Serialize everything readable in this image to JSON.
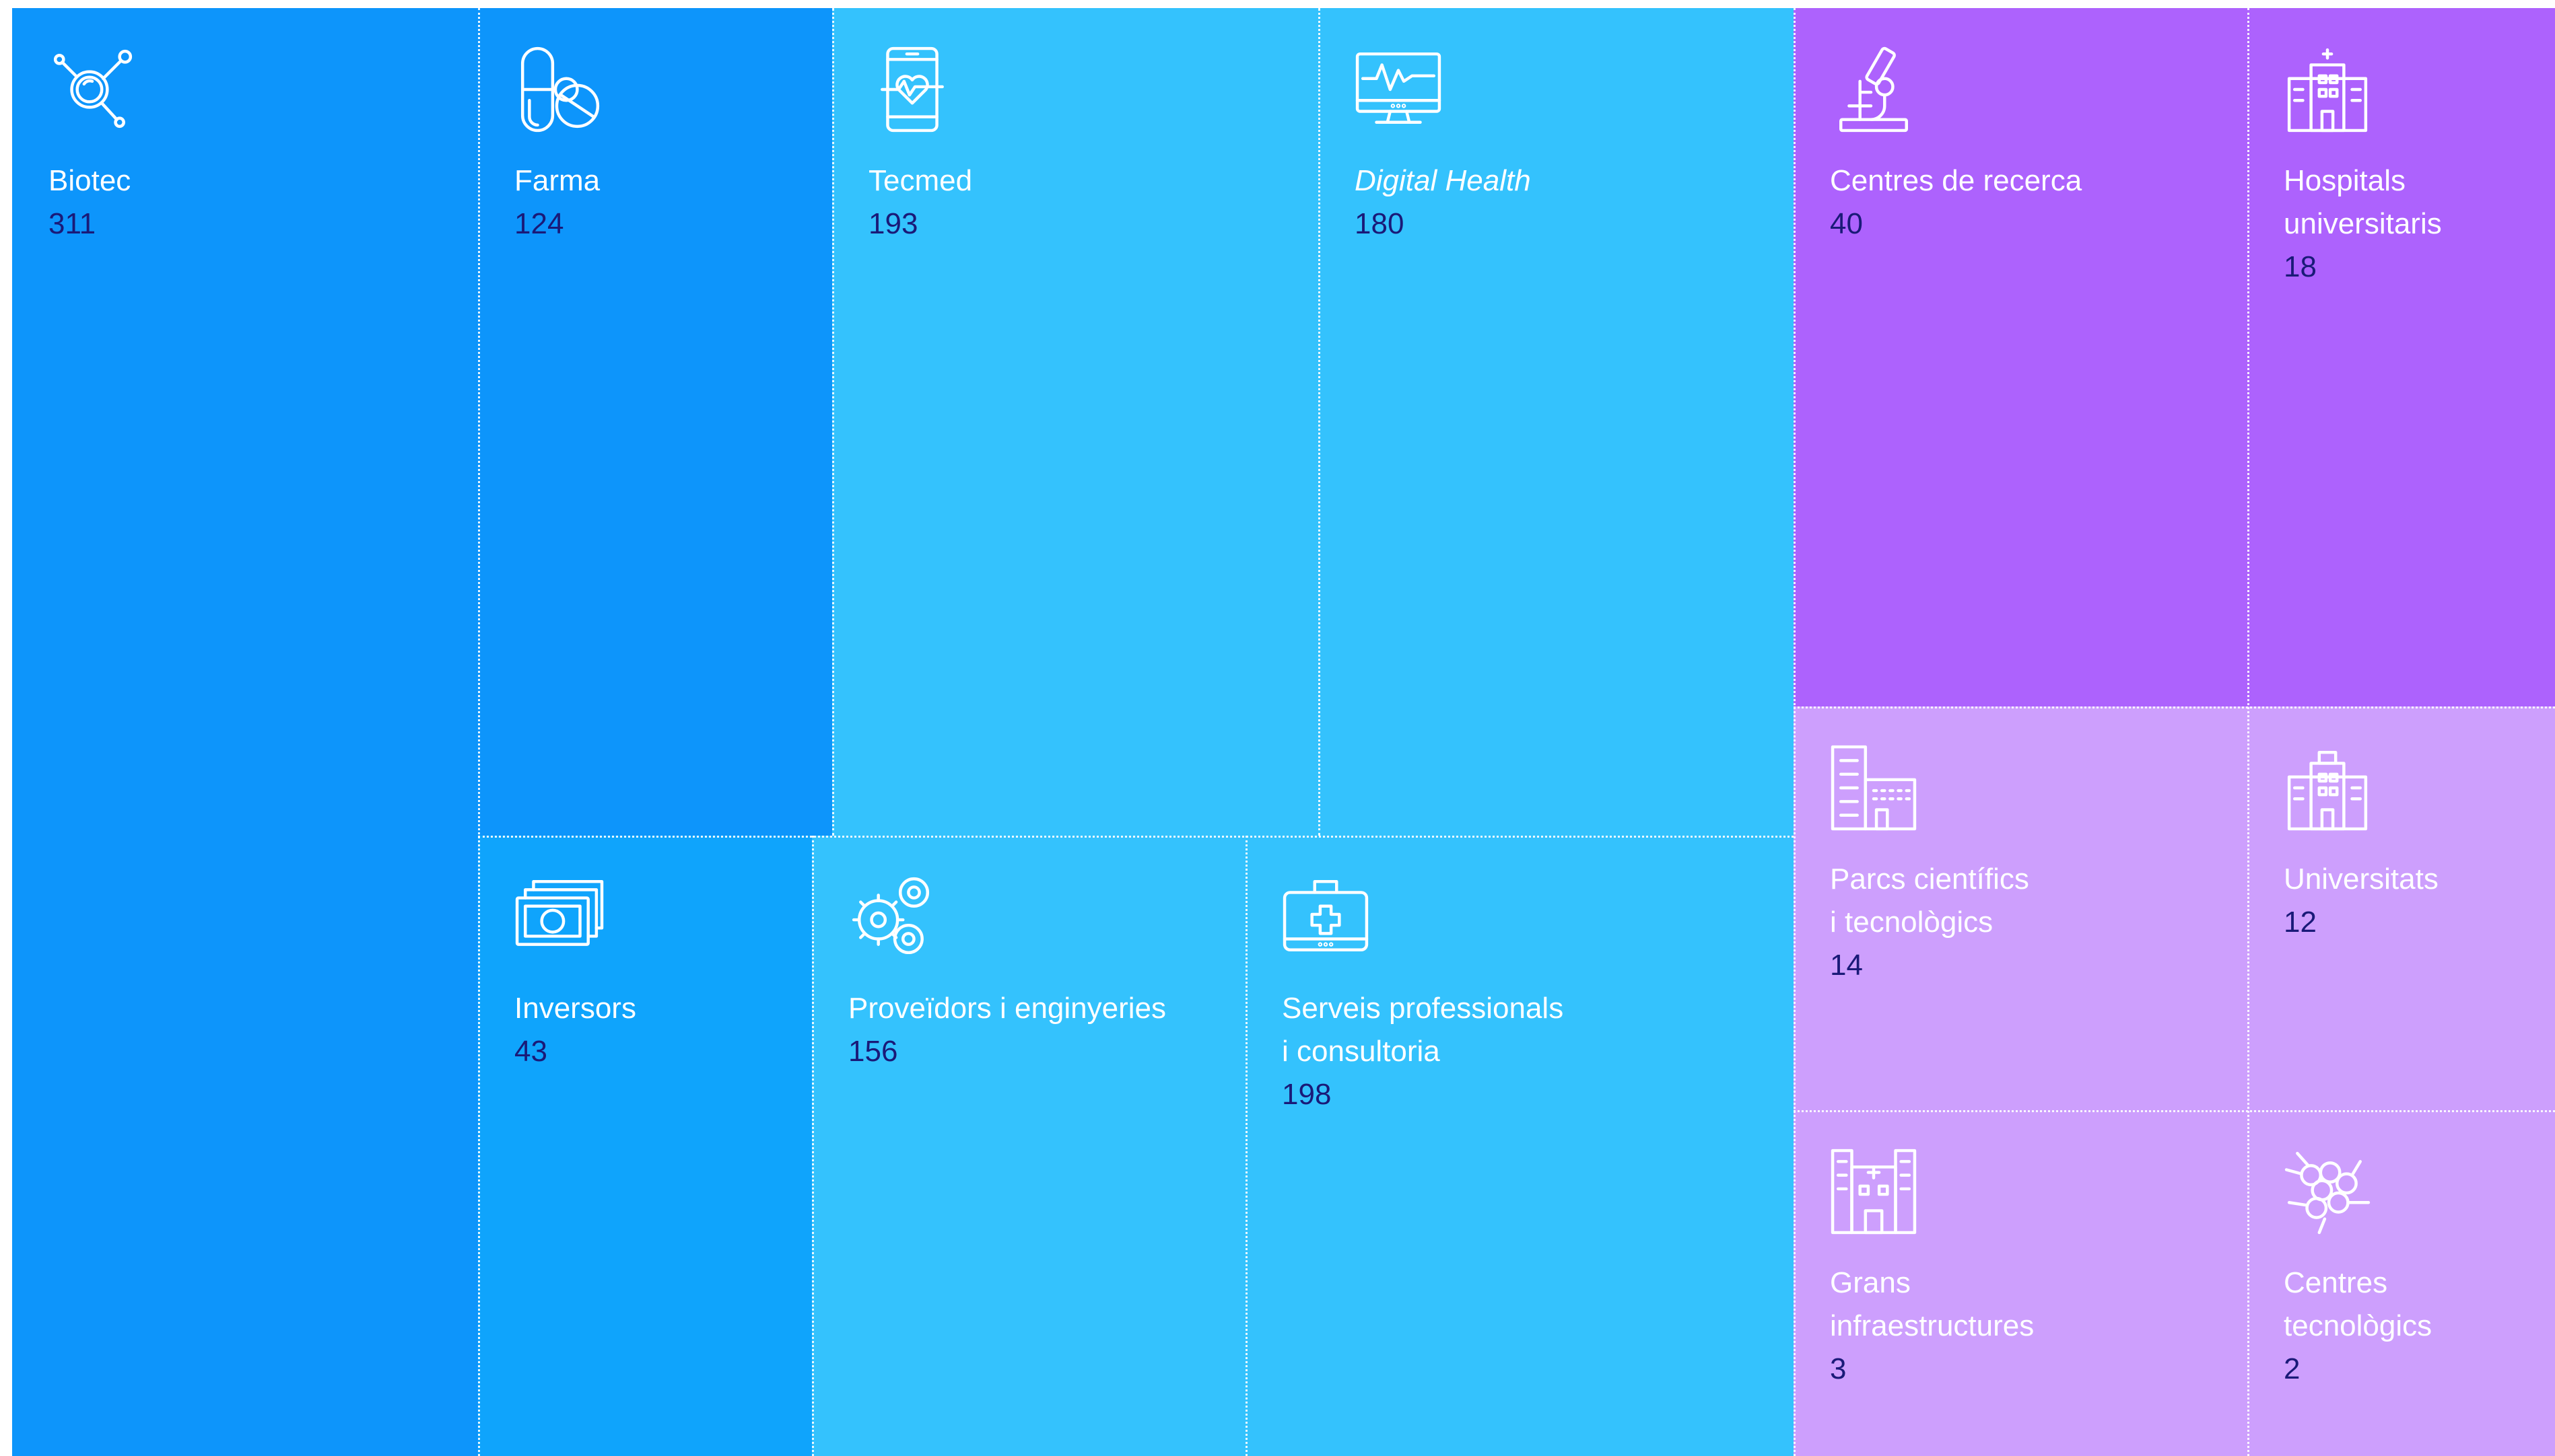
{
  "chart_data": {
    "type": "treemap",
    "title": "",
    "value_color": "#1a1a78",
    "groups": [
      {
        "color": "#0f9bff",
        "items": [
          {
            "label": "Biotec",
            "value": 311,
            "color": "#0d95fb",
            "icon": "molecule-icon"
          },
          {
            "label": "Farma",
            "value": 124,
            "color": "#0d95fb",
            "icon": "pills-icon"
          },
          {
            "label": "Inversors",
            "value": 43,
            "color": "#0fa4fc",
            "icon": "money-icon"
          }
        ]
      },
      {
        "color": "#34c2fd",
        "items": [
          {
            "label": "Tecmed",
            "value": 193,
            "color": "#34c2fd",
            "icon": "smartphone-heart-icon"
          },
          {
            "label": "Digital Health",
            "value": 180,
            "color": "#34c2fd",
            "icon": "monitor-pulse-icon",
            "italic": true
          },
          {
            "label": "Proveïdors i enginyeries",
            "value": 156,
            "color": "#34c2fd",
            "icon": "gears-icon"
          },
          {
            "label": "Serveis professionals\ni consultoria",
            "value": 198,
            "color": "#34c2fd",
            "icon": "first-aid-kit-icon"
          }
        ]
      },
      {
        "color": "#ad62fd",
        "items": [
          {
            "label": "Centres de recerca",
            "value": 40,
            "color": "#ad62fd",
            "icon": "microscope-icon"
          },
          {
            "label": "Hospitals\nuniversitaris",
            "value": 18,
            "color": "#ad62fd",
            "icon": "hospital-icon"
          },
          {
            "label": "Parcs científics\ni tecnològics",
            "value": 14,
            "color": "#cd9ffd",
            "icon": "office-buildings-icon"
          },
          {
            "label": "Universitats",
            "value": 12,
            "color": "#cd9ffd",
            "icon": "university-building-icon"
          },
          {
            "label": "Grans\ninfraestructures",
            "value": 3,
            "color": "#cd9ffd",
            "icon": "large-facility-icon"
          },
          {
            "label": "Centres\ntecnològics",
            "value": 2,
            "color": "#cd9ffd",
            "icon": "network-cluster-icon"
          }
        ]
      }
    ]
  }
}
